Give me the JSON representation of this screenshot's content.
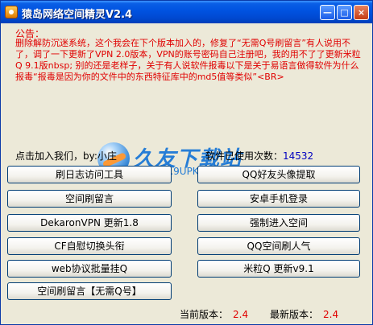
{
  "window": {
    "title": "猿岛网络空间精灵V2.4",
    "minimize_label": "—",
    "maximize_label": "□",
    "close_label": "×"
  },
  "notice": {
    "heading": "公告：",
    "body": "删除解防沉迷系统，这个我会在下个版本加入的，修复了“无需Q号刷留言”有人说用不了，调了一下更新了VPN 2.0版本，VPN的账号密码自己注册吧，我的用不了了更新米粒Q 9.1版nbsp; 别的还是老样子，关于有人说软件报毒以下是关于易语言做得软件为什么报毒“报毒是因为你的文件中的东西特征库中的md5值等类似”<BR>"
  },
  "status": {
    "join_us": "点击加入我们，by:小庄",
    "usage_label": "软件已使用次数：",
    "usage_count": "14532"
  },
  "watermark": {
    "brand": "久友下载站",
    "url": "www.9UPK.Com"
  },
  "buttons": {
    "log_tool": "刷日志访问工具",
    "qq_avatar": "QQ好友头像提取",
    "space_comment": "空间刷留言",
    "android_login": "安卓手机登录",
    "dekaron_vpn": "DekaronVPN 更新1.8",
    "force_enter": "强制进入空间",
    "cf_switch": "CF自慰切换头衔",
    "qq_popularity": "QQ空间刷人气",
    "web_batch": "web协议批量挂Q",
    "mili_q": "米粒Q 更新v9.1",
    "no_qq_comment": "空间刷留言【无需Q号】"
  },
  "version": {
    "current_label": "当前版本：",
    "current_value": "2.4",
    "latest_label": "最新版本：",
    "latest_value": "2.4"
  },
  "colors": {
    "titlebar": "#0054e3",
    "notice_text": "#e00000",
    "count_text": "#0000c0",
    "window_bg": "#ece9d8"
  }
}
